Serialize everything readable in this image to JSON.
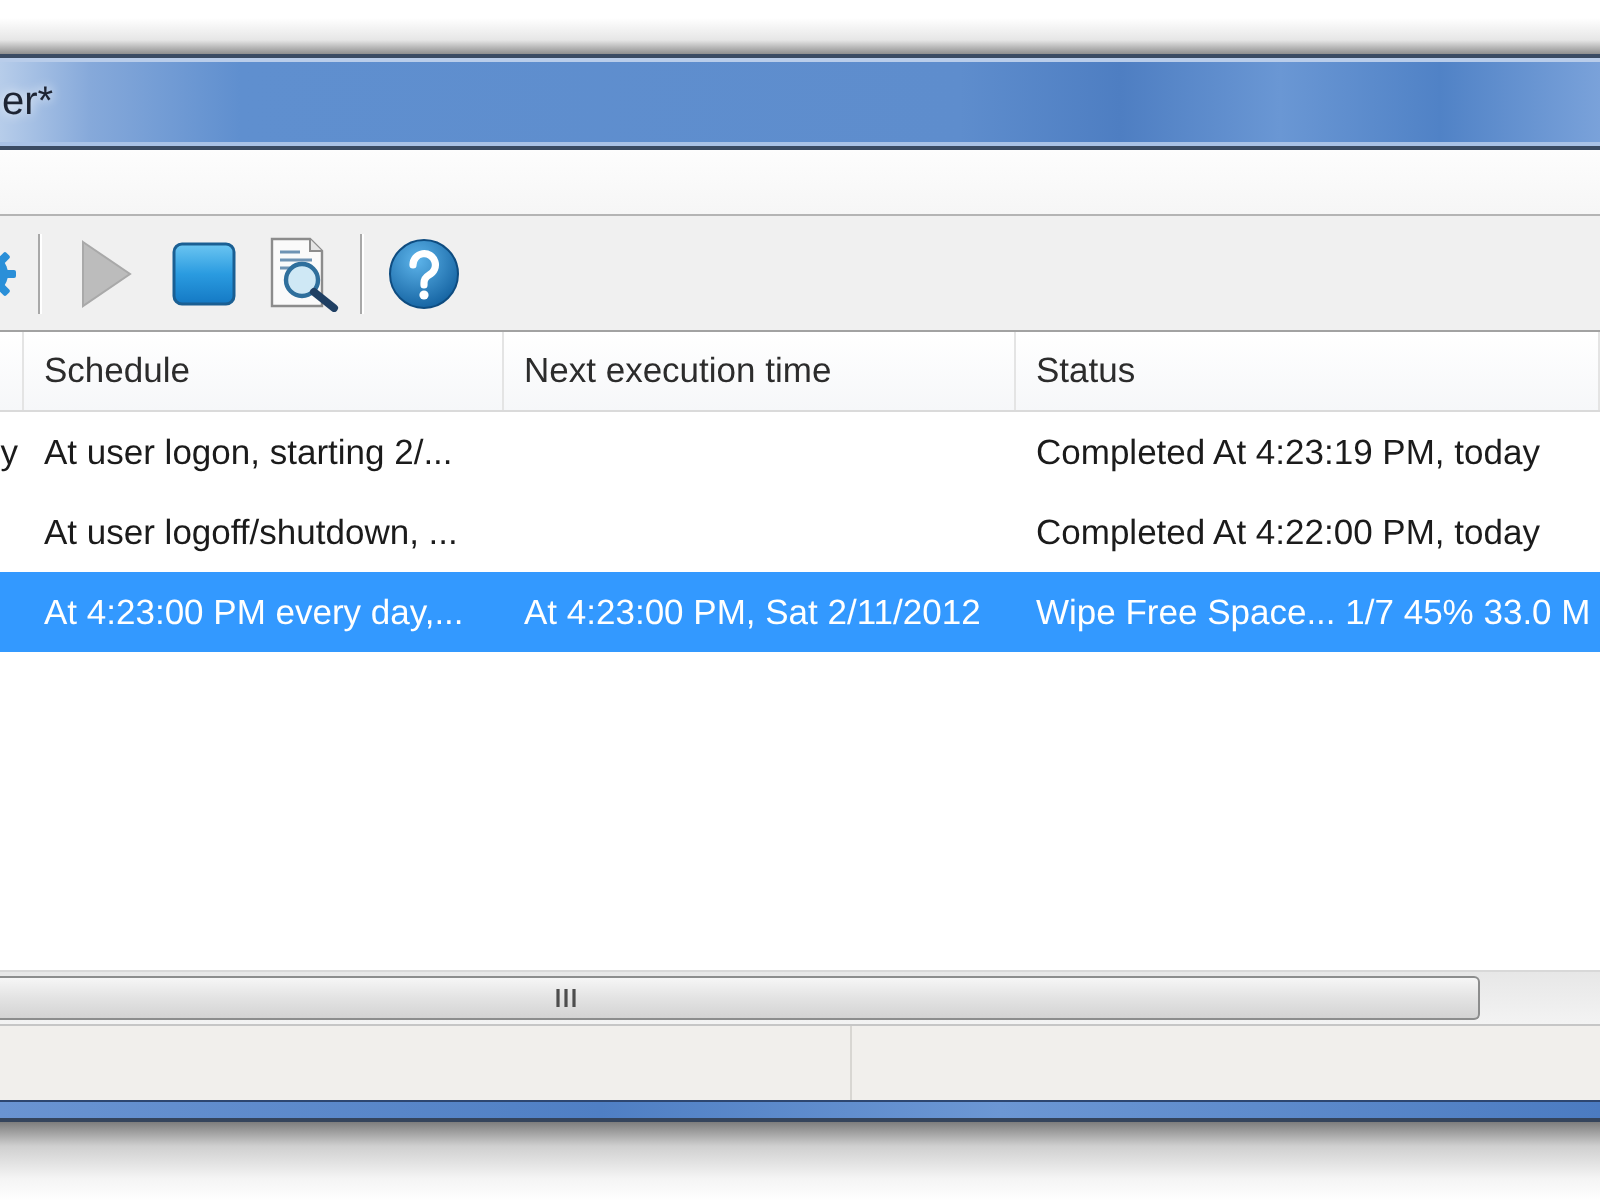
{
  "window": {
    "title": "er*"
  },
  "toolbar": {
    "items": [
      {
        "kind": "gear",
        "disabled": false
      },
      {
        "kind": "separator"
      },
      {
        "kind": "run",
        "disabled": true
      },
      {
        "kind": "stop",
        "disabled": false
      },
      {
        "kind": "log",
        "disabled": false
      },
      {
        "kind": "separator"
      },
      {
        "kind": "help",
        "disabled": false
      }
    ]
  },
  "table": {
    "columns": [
      {
        "label": "Schedule"
      },
      {
        "label": "Next execution time"
      },
      {
        "label": "Status"
      }
    ],
    "rows": [
      {
        "selected": false,
        "column_1": "y",
        "schedule": "At user logon, starting 2/...",
        "status": "Completed At 4:23:19 PM, today"
      },
      {
        "selected": false,
        "schedule": "At user logoff/shutdown, ...",
        "status": "Completed At 4:22:00 PM, today"
      },
      {
        "selected": true,
        "schedule": "At 4:23:00 PM every day,...",
        "next_execution_time": "At 4:23:00 PM, Sat 2/11/2012",
        "status": "Wipe Free Space... 1/7 45% 33.0 M"
      }
    ]
  }
}
